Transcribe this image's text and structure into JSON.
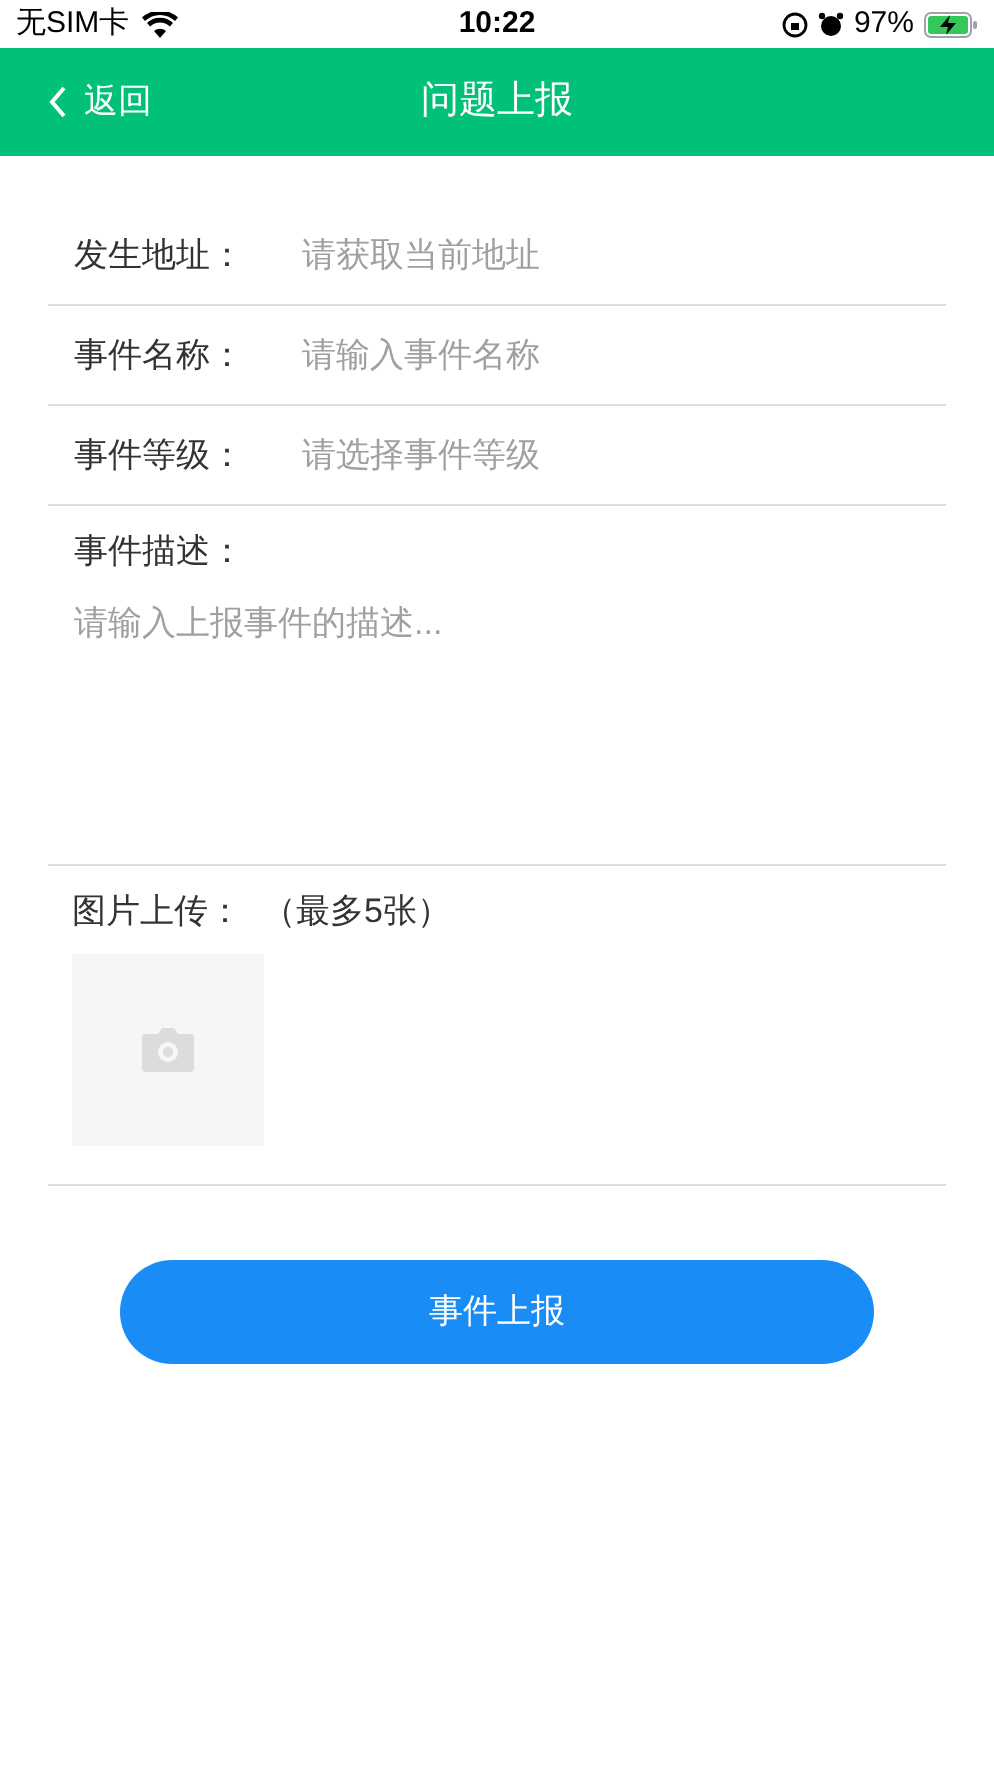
{
  "status_bar": {
    "carrier": "无SIM卡",
    "time": "10:22",
    "battery": "97%"
  },
  "header": {
    "back": "返回",
    "title": "问题上报"
  },
  "fields": [
    {
      "label": "发生地址：",
      "placeholder": "请获取当前地址"
    },
    {
      "label": "事件名称：",
      "placeholder": "请输入事件名称"
    },
    {
      "label": "事件等级：",
      "placeholder": "请选择事件等级"
    }
  ],
  "description": {
    "label": "事件描述：",
    "placeholder": "请输入上报事件的描述..."
  },
  "upload": {
    "label": "图片上传：",
    "hint": "（最多5张）"
  },
  "submit": "事件上报"
}
